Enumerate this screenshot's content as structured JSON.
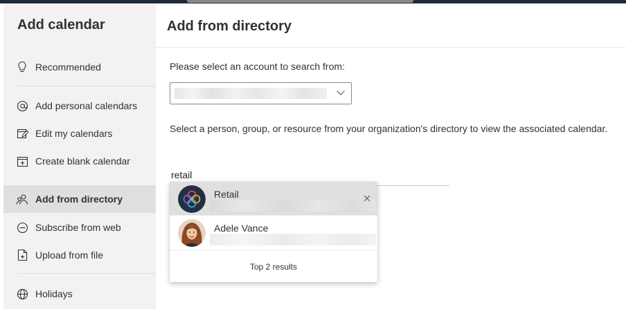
{
  "sidebar": {
    "title": "Add calendar",
    "items": [
      {
        "label": "Recommended",
        "icon": "lightbulb-icon"
      },
      {
        "label": "Add personal calendars",
        "icon": "at-icon"
      },
      {
        "label": "Edit my calendars",
        "icon": "edit-icon"
      },
      {
        "label": "Create blank calendar",
        "icon": "calendar-add-icon"
      },
      {
        "label": "Add from directory",
        "icon": "people-icon",
        "active": true
      },
      {
        "label": "Subscribe from web",
        "icon": "link-circle-icon"
      },
      {
        "label": "Upload from file",
        "icon": "file-upload-icon"
      },
      {
        "label": "Holidays",
        "icon": "globe-icon"
      }
    ]
  },
  "main": {
    "heading": "Add from directory",
    "account_prompt": "Please select an account to search from:",
    "description": "Select a person, group, or resource from your organization's directory to view the associated calendar.",
    "search_value": "retail"
  },
  "results": {
    "items": [
      {
        "name": "Retail"
      },
      {
        "name": "Adele Vance"
      }
    ],
    "footer": "Top 2 results"
  },
  "colors": {
    "sidebar_bg": "#f3f2f1",
    "active_bg": "#e1dfdd",
    "text": "#323130"
  }
}
